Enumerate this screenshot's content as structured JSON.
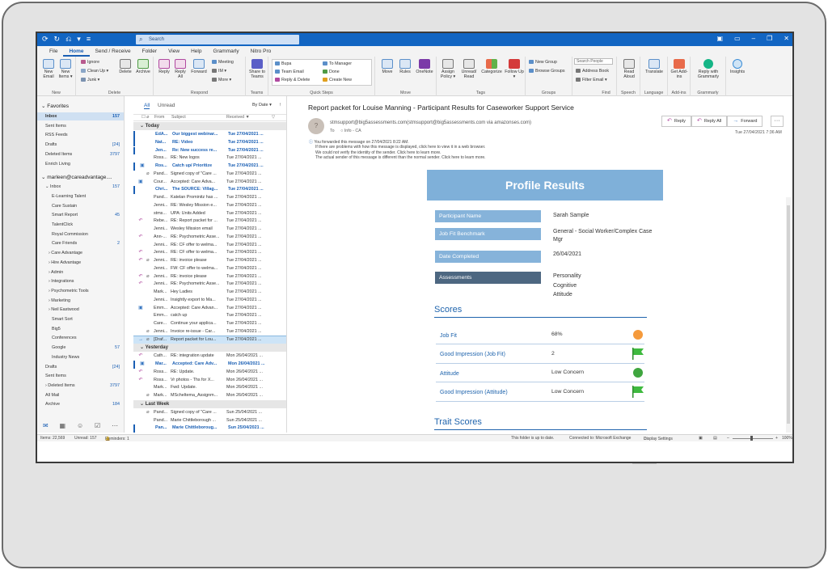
{
  "titlebar": {
    "qat": [
      "⟳",
      "↻",
      "⎌",
      "▾",
      "≡"
    ],
    "search_placeholder": "Search"
  },
  "menu_tabs": [
    "File",
    "Home",
    "Send / Receive",
    "Folder",
    "View",
    "Help",
    "Grammarly",
    "Nitro Pro"
  ],
  "ribbon": {
    "new": {
      "new_email": "New Email",
      "new_items": "New Items ▾",
      "label": "New"
    },
    "delete": {
      "ignore": "Ignore",
      "clean_up": "Clean Up ▾",
      "junk": "Junk ▾",
      "delete": "Delete",
      "archive": "Archive",
      "label": "Delete"
    },
    "respond": {
      "reply": "Reply",
      "reply_all": "Reply All",
      "forward": "Forward",
      "meeting": "Meeting",
      "im": "IM ▾",
      "more": "More ▾",
      "label": "Respond"
    },
    "teams": {
      "share": "Share to Teams",
      "label": "Teams"
    },
    "quick_steps": {
      "items": [
        "Bupa",
        "Team Email",
        "Reply & Delete",
        "To Manager",
        "Done",
        "Create New"
      ],
      "label": "Quick Steps"
    },
    "move": {
      "move": "Move",
      "rules": "Rules",
      "onenote": "OneNote",
      "label": "Move"
    },
    "tags": {
      "assign": "Assign Policy ▾",
      "unread": "Unread/ Read",
      "categorize": "Categorize",
      "follow": "Follow Up ▾",
      "label": "Tags"
    },
    "groups": {
      "new_group": "New Group",
      "browse": "Browse Groups",
      "label": "Groups"
    },
    "find": {
      "search_people": "Search People",
      "address_book": "Address Book",
      "filter": "Filter Email ▾",
      "label": "Find"
    },
    "speech": {
      "read_aloud": "Read Aloud",
      "label": "Speech"
    },
    "language": {
      "translate": "Translate",
      "label": "Language"
    },
    "addins": {
      "get": "Get Add-ins",
      "label": "Add-ins"
    },
    "grammarly": {
      "reply": "Reply with Grammarly",
      "label": "Grammarly"
    },
    "insights": {
      "label": "Insights"
    }
  },
  "nav": {
    "favorites_head": "Favorites",
    "favorites": [
      {
        "name": "Inbox",
        "count": "157"
      },
      {
        "name": "Sent Items",
        "count": ""
      },
      {
        "name": "RSS Feeds",
        "count": ""
      },
      {
        "name": "Drafts",
        "count": "[24]"
      },
      {
        "name": "Deleted Items",
        "count": "3797"
      },
      {
        "name": "Enrich Living",
        "count": ""
      }
    ],
    "account": "marleen@careadvantage....",
    "folders": [
      {
        "name": "Inbox",
        "count": "157"
      },
      {
        "name": "E-Learning Talent",
        "count": ""
      },
      {
        "name": "Care Sustain",
        "count": ""
      },
      {
        "name": "Smart Report",
        "count": "45"
      },
      {
        "name": "TalentClick",
        "count": ""
      },
      {
        "name": "Royal Commission",
        "count": ""
      },
      {
        "name": "Care Friends",
        "count": "2"
      },
      {
        "name": "Care Advantage",
        "count": ""
      },
      {
        "name": "Hire Advantage",
        "count": ""
      },
      {
        "name": "Admin",
        "count": ""
      },
      {
        "name": "Integrations",
        "count": ""
      },
      {
        "name": "Psychometric Tools",
        "count": ""
      },
      {
        "name": "Marketing",
        "count": ""
      },
      {
        "name": "Neil Eastwood",
        "count": ""
      },
      {
        "name": "Smart Sort",
        "count": ""
      },
      {
        "name": "Big5",
        "count": ""
      },
      {
        "name": "Conferences",
        "count": ""
      },
      {
        "name": "Google",
        "count": "57"
      },
      {
        "name": "Industry News",
        "count": ""
      },
      {
        "name": "Drafts",
        "count": "[24]"
      },
      {
        "name": "Sent Items",
        "count": ""
      },
      {
        "name": "Deleted Items",
        "count": "3797"
      },
      {
        "name": "All Mail",
        "count": ""
      },
      {
        "name": "Archive",
        "count": "184"
      }
    ],
    "icons": [
      "✉",
      "▦",
      "☺",
      "☑",
      "⋯"
    ]
  },
  "msglist": {
    "filter_all": "All",
    "filter_unread": "Unread",
    "sort": "By Date ▾",
    "col_from": "From",
    "col_subject": "Subject",
    "col_received": "Received ▼",
    "groups": [
      "Today",
      "Yesterday",
      "Last Week"
    ],
    "today": [
      {
        "ic": "",
        "att": "",
        "from": "EdA...",
        "sub": "Our biggest webinar...",
        "date": "Tue 27/04/2021 ...",
        "unread": true
      },
      {
        "ic": "",
        "att": "",
        "from": "Nat...",
        "sub": "RE: Video",
        "date": "Tue 27/04/2021 ...",
        "unread": true
      },
      {
        "ic": "",
        "att": "",
        "from": "Jen...",
        "sub": "Re: New success re...",
        "date": "Tue 27/04/2021 ...",
        "unread": true
      },
      {
        "ic": "",
        "att": "",
        "from": "Ross...",
        "sub": "RE: New logos",
        "date": "Tue 27/04/2021 ...",
        "unread": false
      },
      {
        "ic": "▣",
        "att": "",
        "from": "Ros...",
        "sub": "Catch up/ Prioritize",
        "date": "Tue 27/04/2021 ...",
        "unread": true
      },
      {
        "ic": "",
        "att": "⌀",
        "from": "Pand...",
        "sub": "Signed copy of \"Care ...",
        "date": "Tue 27/04/2021 ...",
        "unread": false
      },
      {
        "ic": "▣",
        "att": "",
        "from": "Cour...",
        "sub": "Accepted: Care Adva...",
        "date": "Tue 27/04/2021 ...",
        "unread": false
      },
      {
        "ic": "",
        "att": "",
        "from": "Chri...",
        "sub": "The SOURCE: Villag...",
        "date": "Tue 27/04/2021 ...",
        "unread": true
      },
      {
        "ic": "",
        "att": "",
        "from": "Pand...",
        "sub": "Katelan Prominitz has ...",
        "date": "Tue 27/04/2021 ...",
        "unread": false
      },
      {
        "ic": "",
        "att": "",
        "from": "Jenni...",
        "sub": "RE: Wesley Mission e...",
        "date": "Tue 27/04/2021 ...",
        "unread": false
      },
      {
        "ic": "",
        "att": "",
        "from": "stms...",
        "sub": "UPA: Units Added",
        "date": "Tue 27/04/2021 ...",
        "unread": false
      },
      {
        "ic": "↶",
        "att": "",
        "from": "Rebe...",
        "sub": "RE: Report packet for ...",
        "date": "Tue 27/04/2021 ...",
        "unread": false
      },
      {
        "ic": "",
        "att": "",
        "from": "Jenni...",
        "sub": "Wesley Mission email",
        "date": "Tue 27/04/2021 ...",
        "unread": false
      },
      {
        "ic": "↶",
        "att": "",
        "from": "Ann-...",
        "sub": "RE: Psychometric Asse...",
        "date": "Tue 27/04/2021 ...",
        "unread": false
      },
      {
        "ic": "",
        "att": "",
        "from": "Jenni...",
        "sub": "RE: CF offer to welma...",
        "date": "Tue 27/04/2021 ...",
        "unread": false
      },
      {
        "ic": "↶",
        "att": "",
        "from": "Jenni...",
        "sub": "RE: CF offer to welma...",
        "date": "Tue 27/04/2021 ...",
        "unread": false
      },
      {
        "ic": "↶",
        "att": "⌀",
        "from": "Jenni...",
        "sub": "RE: invoice please",
        "date": "Tue 27/04/2021 ...",
        "unread": false
      },
      {
        "ic": "",
        "att": "",
        "from": "Jenni...",
        "sub": "FW: CF offer to welma...",
        "date": "Tue 27/04/2021 ...",
        "unread": false
      },
      {
        "ic": "↶",
        "att": "⌀",
        "from": "Jenni...",
        "sub": "RE: invoice please",
        "date": "Tue 27/04/2021 ...",
        "unread": false
      },
      {
        "ic": "↶",
        "att": "",
        "from": "Jenni...",
        "sub": "RE: Psychometric Asse...",
        "date": "Tue 27/04/2021 ...",
        "unread": false
      },
      {
        "ic": "",
        "att": "",
        "from": "Mark...",
        "sub": "Hey Ladies",
        "date": "Tue 27/04/2021 ...",
        "unread": false
      },
      {
        "ic": "",
        "att": "",
        "from": "Jenni...",
        "sub": "Insightly export to Ma...",
        "date": "Tue 27/04/2021 ...",
        "unread": false
      },
      {
        "ic": "▣",
        "att": "",
        "from": "Emm...",
        "sub": "Accepted: Care Advan...",
        "date": "Tue 27/04/2021 ...",
        "unread": false
      },
      {
        "ic": "",
        "att": "",
        "from": "Emm...",
        "sub": "catch up",
        "date": "Tue 27/04/2021 ...",
        "unread": false
      },
      {
        "ic": "",
        "att": "",
        "from": "Care...",
        "sub": "Continue your applica...",
        "date": "Tue 27/04/2021 ...",
        "unread": false
      },
      {
        "ic": "",
        "att": "⌀",
        "from": "Jenni...",
        "sub": "Invoice re-issue - Car...",
        "date": "Tue 27/04/2021 ...",
        "unread": false
      },
      {
        "ic": "→",
        "att": "⌀",
        "from": "[Draf...",
        "sub": "Report packet for Lou...",
        "date": "Tue 27/04/2021 ...",
        "unread": false,
        "sel": true
      }
    ],
    "yesterday": [
      {
        "ic": "↶",
        "att": "",
        "from": "Cath...",
        "sub": "RE: integration update",
        "date": "Mon 26/04/2021 ...",
        "unread": false
      },
      {
        "ic": "▣",
        "att": "",
        "from": "Mar...",
        "sub": "Accepted: Care Adv...",
        "date": "Mon 26/04/2021 ...",
        "unread": true
      },
      {
        "ic": "↶",
        "att": "",
        "from": "Ross...",
        "sub": "RE: Update.",
        "date": "Mon 26/04/2021 ...",
        "unread": false
      },
      {
        "ic": "↶",
        "att": "",
        "from": "Ross...",
        "sub": "Vr photos - Ths for X...",
        "date": "Mon 26/04/2021 ...",
        "unread": false
      },
      {
        "ic": "",
        "att": "",
        "from": "Mark...",
        "sub": "Fwd: Update.",
        "date": "Mon 26/04/2021 ...",
        "unread": false
      },
      {
        "ic": "",
        "att": "⌀",
        "from": "Mark...",
        "sub": "MScheltema_Assignm...",
        "date": "Mon 26/04/2021 ...",
        "unread": false
      }
    ],
    "lastweek": [
      {
        "ic": "",
        "att": "⌀",
        "from": "Pand...",
        "sub": "Signed copy of \"Care ...",
        "date": "Sun 25/04/2021 ...",
        "unread": false
      },
      {
        "ic": "",
        "att": "",
        "from": "Pand...",
        "sub": "Marie Chittleborough ...",
        "date": "Sun 25/04/2021 ...",
        "unread": false
      },
      {
        "ic": "",
        "att": "",
        "from": "Pan...",
        "sub": "Marie Chittleboroug...",
        "date": "Sun 25/04/2021 ...",
        "unread": true
      }
    ]
  },
  "reading": {
    "subject": "Report packet for Louise Manning - Participant Results for Caseworker Support Service",
    "avatar": "?",
    "sender": "stmsupport@big5assessments.com(stmsupport@big5assessments.com via amazonses.com)",
    "to_label": "To",
    "to_value": "Info - CA",
    "reply": "Reply",
    "reply_all": "Reply All",
    "forward": "Forward",
    "more": "···",
    "date": "Tue 27/04/2021 7:36 AM",
    "info_lines": [
      "You forwarded this message on 27/04/2021 8:22 AM.",
      "If there are problems with how this message is displayed, click here to view it in a web browser.",
      "We could not verify the identity of the sender. Click here to learn more.",
      "The actual sender of this message is different than the normal sender. Click here to learn more."
    ],
    "banner": "Profile Results",
    "fields": [
      {
        "label": "Participant Name",
        "value": "Sarah Sample"
      },
      {
        "label": "Job Fit Benchmark",
        "value": "General - Social Worker/Complex Case Mgr"
      },
      {
        "label": "Date Completed",
        "value": "26/04/2021"
      },
      {
        "label": "Assessments",
        "value": [
          "Personality",
          "Cognitive",
          "Attitude"
        ]
      }
    ],
    "scores_head": "Scores",
    "scores": [
      {
        "name": "Job Fit",
        "value": "68%",
        "indicator": "orange-circle",
        "color": "#f59a3c"
      },
      {
        "name": "Good Impression (Job Fit)",
        "value": "2",
        "indicator": "green-flag",
        "color": "#3fba3f"
      },
      {
        "name": "Attitude",
        "value": "Low Concern",
        "indicator": "green-circle",
        "color": "#3fa63f"
      },
      {
        "name": "Good Impression (Attitude)",
        "value": "Low Concern",
        "indicator": "green-flag",
        "color": "#3fba3f"
      }
    ],
    "trait_head": "Trait Scores"
  },
  "status": {
    "items": "Items: 22,569",
    "unread": "Unread: 157",
    "reminders": "Reminders: 1",
    "folder": "This folder is up to date.",
    "connected": "Connected to: Microsoft Exchange",
    "display": "Display Settings",
    "zoom": "100%"
  }
}
